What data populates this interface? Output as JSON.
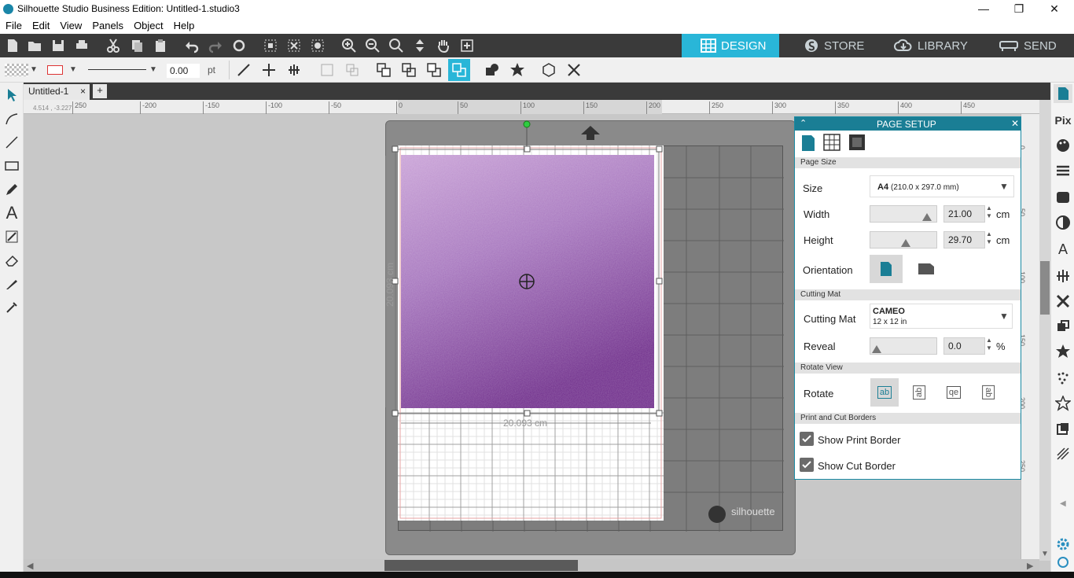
{
  "window": {
    "title": "Silhouette Studio Business Edition: Untitled-1.studio3"
  },
  "menu": [
    "File",
    "Edit",
    "View",
    "Panels",
    "Object",
    "Help"
  ],
  "nav_tabs": [
    {
      "label": "DESIGN",
      "active": true,
      "icon": "grid-icon"
    },
    {
      "label": "STORE",
      "active": false,
      "icon": "silhouette-s-icon"
    },
    {
      "label": "LIBRARY",
      "active": false,
      "icon": "cloud-download-icon"
    },
    {
      "label": "SEND",
      "active": false,
      "icon": "cutter-icon"
    }
  ],
  "toolbar2": {
    "line_width": "0.00",
    "line_unit": "pt"
  },
  "doc_tab": {
    "label": "Untitled-1",
    "close": "×",
    "add": "+"
  },
  "ruler": {
    "coords": "4.514 , -3.227",
    "top_ticks": [
      "250",
      "-200",
      "-150",
      "-100",
      "-50",
      "0",
      "50",
      "100",
      "150",
      "200",
      "250",
      "300",
      "350",
      "400",
      "450"
    ],
    "right_ticks": [
      "0",
      "50",
      "100",
      "150",
      "200",
      "250"
    ]
  },
  "canvas": {
    "width_dim": "20.093 cm",
    "height_dim": "20.093 cm",
    "mat_brand": "silhouette"
  },
  "page_setup": {
    "title": "PAGE SETUP",
    "sections": {
      "page_size": "Page Size",
      "cutting_mat": "Cutting Mat",
      "rotate_view": "Rotate View",
      "borders": "Print and Cut Borders"
    },
    "size_label": "Size",
    "size_value_bold": "A4",
    "size_value_detail": "(210.0 x 297.0 mm)",
    "width_label": "Width",
    "width_value": "21.00",
    "width_unit": "cm",
    "height_label": "Height",
    "height_value": "29.70",
    "height_unit": "cm",
    "orientation_label": "Orientation",
    "cutting_mat_label": "Cutting Mat",
    "cutting_mat_value": "CAMEO",
    "cutting_mat_detail": "12 x 12 in",
    "reveal_label": "Reveal",
    "reveal_value": "0.0",
    "reveal_unit": "%",
    "rotate_label": "Rotate",
    "rotate_options": [
      "ab",
      "ab",
      "qe",
      "ab"
    ],
    "show_print_border": "Show Print Border",
    "show_cut_border": "Show Cut Border"
  },
  "colors": {
    "accent": "#1a8aa3",
    "active_tab": "#29b6d8",
    "dark_bar": "#3a3a3a",
    "glitter": "#8e4fa8"
  }
}
